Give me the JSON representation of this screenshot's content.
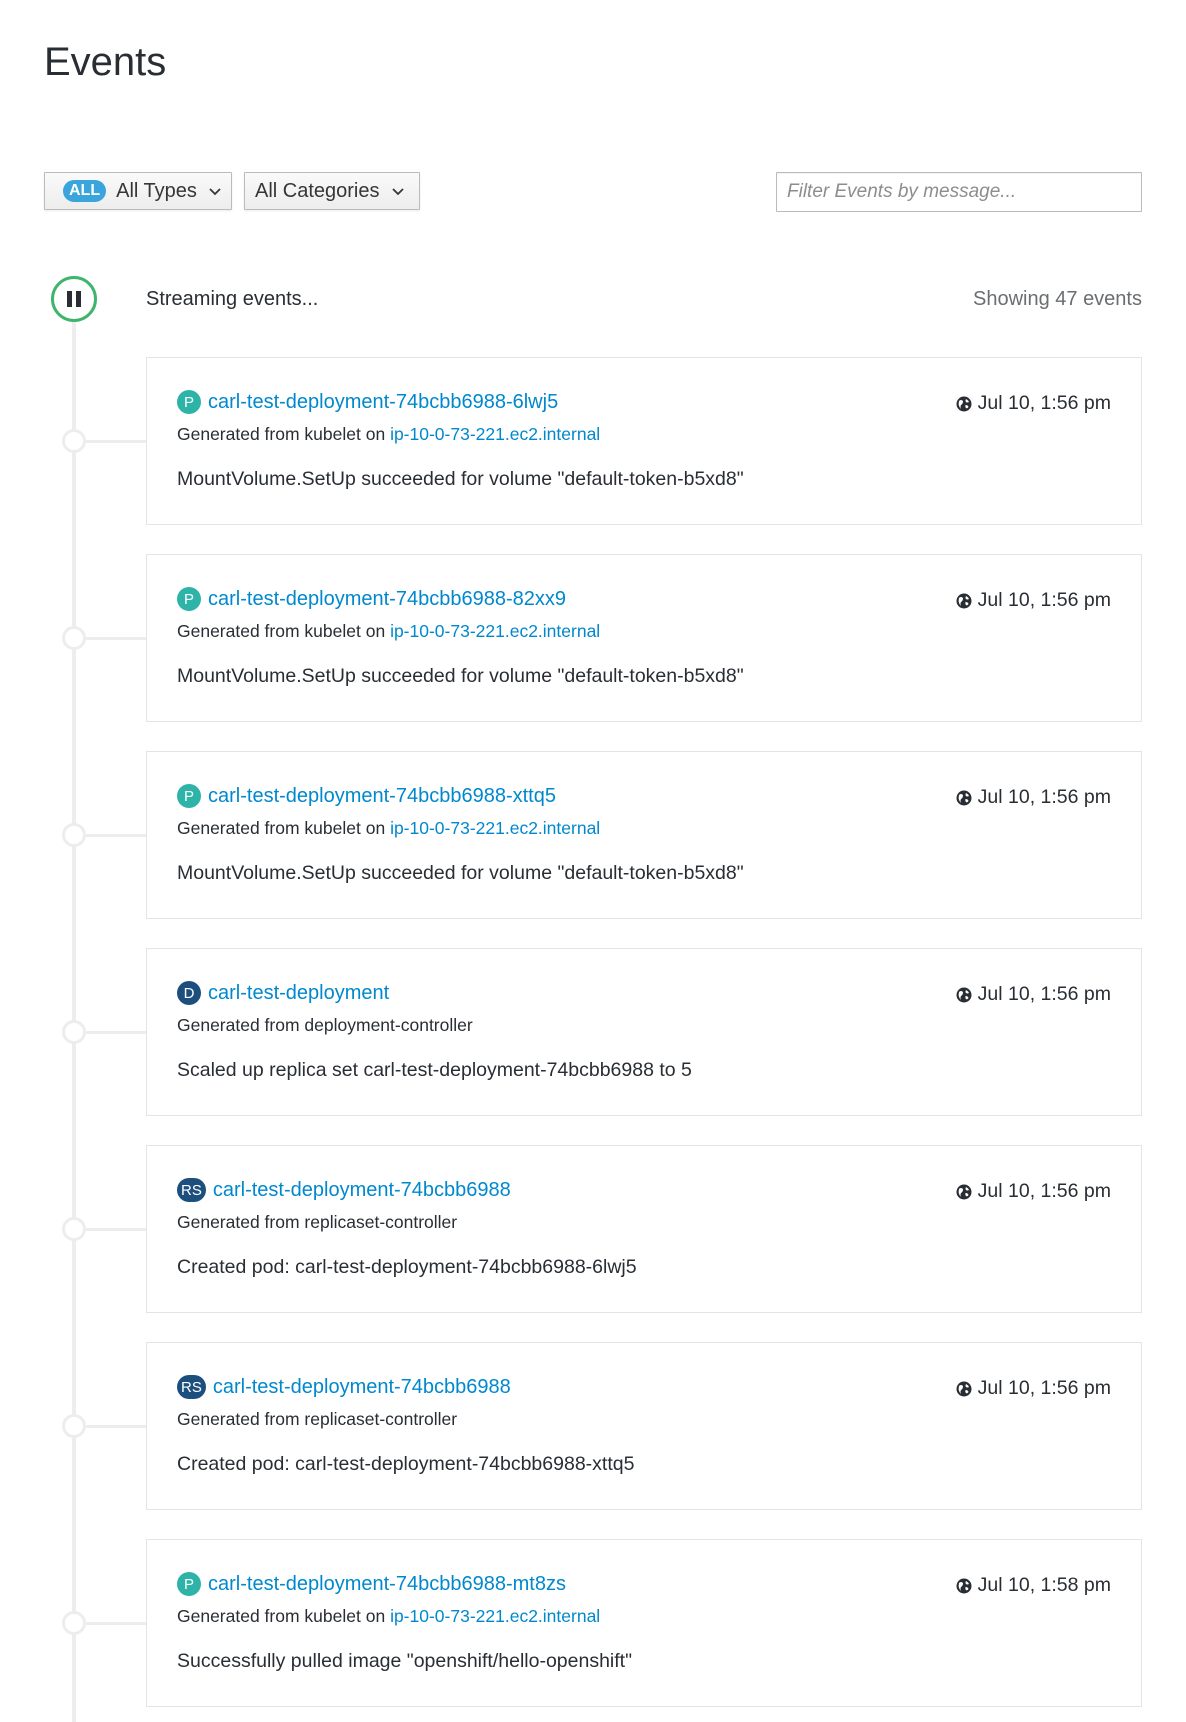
{
  "page": {
    "title": "Events"
  },
  "toolbar": {
    "types_badge": "ALL",
    "types_label": "All Types",
    "categories_label": "All Categories",
    "filter_placeholder": "Filter Events by message..."
  },
  "stream": {
    "status": "Streaming events...",
    "count": "Showing 47 events"
  },
  "colors": {
    "pod": "#2eb3a9",
    "deployment": "#1d4f7e",
    "replicaset": "#1d4f7e",
    "link": "#0088ce",
    "streaming": "#3fb46b"
  },
  "events": [
    {
      "kind": "P",
      "resource": "carl-test-deployment-74bcbb6988-6lwj5",
      "source_prefix": "Generated from kubelet on",
      "source_host": "ip-10-0-73-221.ec2.internal",
      "message": "MountVolume.SetUp succeeded for volume \"default-token-b5xd8\"",
      "time": "Jul 10, 1:56 pm"
    },
    {
      "kind": "P",
      "resource": "carl-test-deployment-74bcbb6988-82xx9",
      "source_prefix": "Generated from kubelet on",
      "source_host": "ip-10-0-73-221.ec2.internal",
      "message": "MountVolume.SetUp succeeded for volume \"default-token-b5xd8\"",
      "time": "Jul 10, 1:56 pm"
    },
    {
      "kind": "P",
      "resource": "carl-test-deployment-74bcbb6988-xttq5",
      "source_prefix": "Generated from kubelet on",
      "source_host": "ip-10-0-73-221.ec2.internal",
      "message": "MountVolume.SetUp succeeded for volume \"default-token-b5xd8\"",
      "time": "Jul 10, 1:56 pm"
    },
    {
      "kind": "D",
      "resource": "carl-test-deployment",
      "source_prefix": "Generated from deployment-controller",
      "source_host": "",
      "message": "Scaled up replica set carl-test-deployment-74bcbb6988 to 5",
      "time": "Jul 10, 1:56 pm"
    },
    {
      "kind": "RS",
      "resource": "carl-test-deployment-74bcbb6988",
      "source_prefix": "Generated from replicaset-controller",
      "source_host": "",
      "message": "Created pod: carl-test-deployment-74bcbb6988-6lwj5",
      "time": "Jul 10, 1:56 pm"
    },
    {
      "kind": "RS",
      "resource": "carl-test-deployment-74bcbb6988",
      "source_prefix": "Generated from replicaset-controller",
      "source_host": "",
      "message": "Created pod: carl-test-deployment-74bcbb6988-xttq5",
      "time": "Jul 10, 1:56 pm"
    },
    {
      "kind": "P",
      "resource": "carl-test-deployment-74bcbb6988-mt8zs",
      "source_prefix": "Generated from kubelet on",
      "source_host": "ip-10-0-73-221.ec2.internal",
      "message": "Successfully pulled image \"openshift/hello-openshift\"",
      "time": "Jul 10, 1:58 pm"
    }
  ]
}
